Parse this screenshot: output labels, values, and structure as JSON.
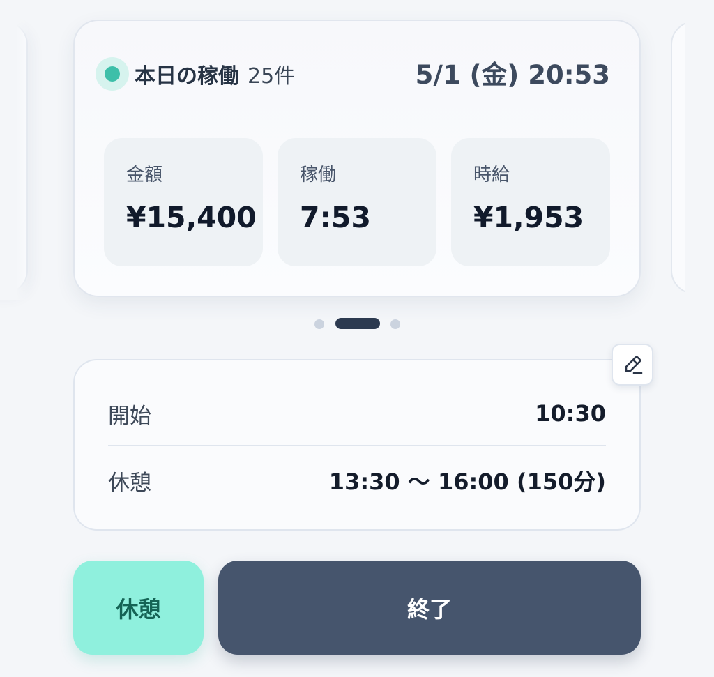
{
  "summary": {
    "status_label": "本日の稼働",
    "status_count": "25件",
    "datetime": "5/1 (金) 20:53",
    "stats": [
      {
        "label": "金額",
        "value": "¥15,400"
      },
      {
        "label": "稼働",
        "value": "7:53"
      },
      {
        "label": "時給",
        "value": "¥1,953"
      }
    ]
  },
  "pager": {
    "pages": 3,
    "active_index": 1
  },
  "shift": {
    "rows": [
      {
        "label": "開始",
        "value": "10:30"
      },
      {
        "label": "休憩",
        "value": "13:30 〜 16:00 (150分)"
      }
    ],
    "edit_icon": "pencil-icon"
  },
  "actions": {
    "break_label": "休憩",
    "end_label": "終了"
  },
  "colors": {
    "status_dot": "#3dbfa9",
    "break_button": "#8ff0dd",
    "end_button": "#46556d",
    "pager_active": "#2c3a50"
  }
}
